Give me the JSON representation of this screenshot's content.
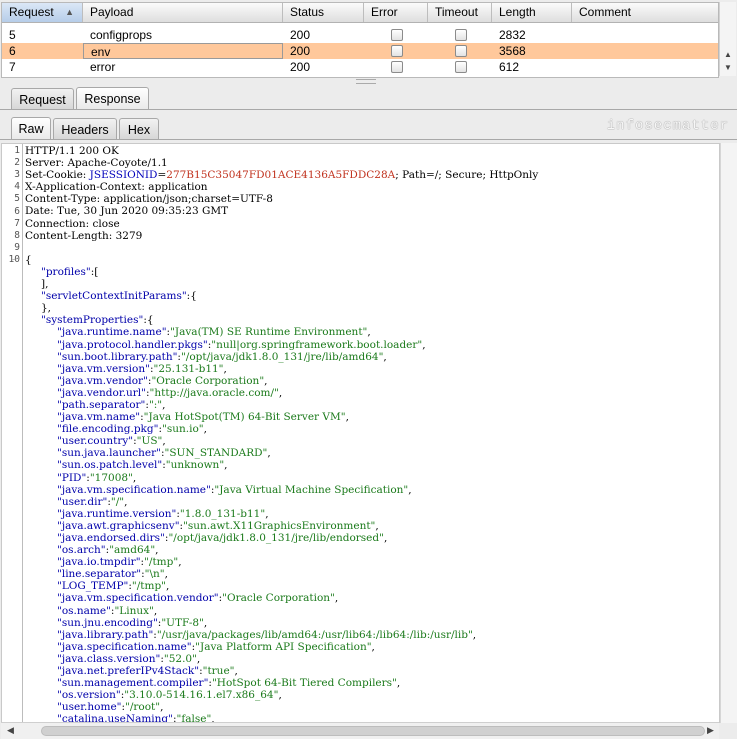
{
  "results_table": {
    "columns": [
      {
        "label": "Request"
      },
      {
        "label": "Payload"
      },
      {
        "label": "Status"
      },
      {
        "label": "Error"
      },
      {
        "label": "Timeout"
      },
      {
        "label": "Length"
      },
      {
        "label": "Comment"
      }
    ],
    "rows": [
      {
        "request": "5",
        "payload": "configprops",
        "status": "200",
        "length": "2832",
        "comment": "",
        "selected": false
      },
      {
        "request": "6",
        "payload": "env",
        "status": "200",
        "length": "3568",
        "comment": "",
        "selected": true
      },
      {
        "request": "7",
        "payload": "error",
        "status": "200",
        "length": "612",
        "comment": "",
        "selected": false
      }
    ]
  },
  "tabs": {
    "main": [
      "Request",
      "Response"
    ],
    "active_main": "Response",
    "view": [
      "Raw",
      "Headers",
      "Hex"
    ],
    "active_view": "Raw"
  },
  "watermark": "infosecmatter",
  "response": {
    "headers": [
      {
        "plain": "HTTP/1.1 200 OK"
      },
      {
        "plain": "Server: Apache-Coyote/1.1"
      },
      {
        "cookie_prefix": "Set-Cookie: ",
        "cookie_name": "JSESSIONID",
        "cookie_eq": "=",
        "cookie_value": "277B15C35047FD01ACE4136A5FDDC28A",
        "cookie_rest": "; Path=/; Secure; HttpOnly"
      },
      {
        "plain": "X-Application-Context: application"
      },
      {
        "plain": "Content-Type: application/json;charset=UTF-8"
      },
      {
        "plain": "Date: Tue, 30 Jun 2020 09:35:23 GMT"
      },
      {
        "plain": "Connection: close"
      },
      {
        "plain": "Content-Length: 3279"
      },
      {
        "plain": ""
      }
    ],
    "body_lines": [
      {
        "indent": 0,
        "pre": "{"
      },
      {
        "indent": 1,
        "key": "\"profiles\"",
        "post": ":["
      },
      {
        "indent": 1,
        "pre": "],"
      },
      {
        "indent": 1,
        "key": "\"servletContextInitParams\"",
        "post": ":{"
      },
      {
        "indent": 1,
        "pre": "},"
      },
      {
        "indent": 1,
        "key": "\"systemProperties\"",
        "post": ":{"
      },
      {
        "indent": 2,
        "key": "\"java.runtime.name\"",
        "val": "\"Java(TM) SE Runtime Environment\"",
        "post": ","
      },
      {
        "indent": 2,
        "key": "\"java.protocol.handler.pkgs\"",
        "val": "\"null|org.springframework.boot.loader\"",
        "post": ","
      },
      {
        "indent": 2,
        "key": "\"sun.boot.library.path\"",
        "val": "\"/opt/java/jdk1.8.0_131/jre/lib/amd64\"",
        "post": ","
      },
      {
        "indent": 2,
        "key": "\"java.vm.version\"",
        "val": "\"25.131-b11\"",
        "post": ","
      },
      {
        "indent": 2,
        "key": "\"java.vm.vendor\"",
        "val": "\"Oracle Corporation\"",
        "post": ","
      },
      {
        "indent": 2,
        "key": "\"java.vendor.url\"",
        "val": "\"http://java.oracle.com/\"",
        "post": ","
      },
      {
        "indent": 2,
        "key": "\"path.separator\"",
        "val": "\":\"",
        "post": ","
      },
      {
        "indent": 2,
        "key": "\"java.vm.name\"",
        "val": "\"Java HotSpot(TM) 64-Bit Server VM\"",
        "post": ","
      },
      {
        "indent": 2,
        "key": "\"file.encoding.pkg\"",
        "val": "\"sun.io\"",
        "post": ","
      },
      {
        "indent": 2,
        "key": "\"user.country\"",
        "val": "\"US\"",
        "post": ","
      },
      {
        "indent": 2,
        "key": "\"sun.java.launcher\"",
        "val": "\"SUN_STANDARD\"",
        "post": ","
      },
      {
        "indent": 2,
        "key": "\"sun.os.patch.level\"",
        "val": "\"unknown\"",
        "post": ","
      },
      {
        "indent": 2,
        "key": "\"PID\"",
        "val": "\"17008\"",
        "post": ","
      },
      {
        "indent": 2,
        "key": "\"java.vm.specification.name\"",
        "val": "\"Java Virtual Machine Specification\"",
        "post": ","
      },
      {
        "indent": 2,
        "key": "\"user.dir\"",
        "val": "\"/\"",
        "post": ","
      },
      {
        "indent": 2,
        "key": "\"java.runtime.version\"",
        "val": "\"1.8.0_131-b11\"",
        "post": ","
      },
      {
        "indent": 2,
        "key": "\"java.awt.graphicsenv\"",
        "val": "\"sun.awt.X11GraphicsEnvironment\"",
        "post": ","
      },
      {
        "indent": 2,
        "key": "\"java.endorsed.dirs\"",
        "val": "\"/opt/java/jdk1.8.0_131/jre/lib/endorsed\"",
        "post": ","
      },
      {
        "indent": 2,
        "key": "\"os.arch\"",
        "val": "\"amd64\"",
        "post": ","
      },
      {
        "indent": 2,
        "key": "\"java.io.tmpdir\"",
        "val": "\"/tmp\"",
        "post": ","
      },
      {
        "indent": 2,
        "key": "\"line.separator\"",
        "val": "\"\\n\"",
        "post": ","
      },
      {
        "indent": 2,
        "key": "\"LOG_TEMP\"",
        "val": "\"/tmp\"",
        "post": ","
      },
      {
        "indent": 2,
        "key": "\"java.vm.specification.vendor\"",
        "val": "\"Oracle Corporation\"",
        "post": ","
      },
      {
        "indent": 2,
        "key": "\"os.name\"",
        "val": "\"Linux\"",
        "post": ","
      },
      {
        "indent": 2,
        "key": "\"sun.jnu.encoding\"",
        "val": "\"UTF-8\"",
        "post": ","
      },
      {
        "indent": 2,
        "key": "\"java.library.path\"",
        "val": "\"/usr/java/packages/lib/amd64:/usr/lib64:/lib64:/lib:/usr/lib\"",
        "post": ","
      },
      {
        "indent": 2,
        "key": "\"java.specification.name\"",
        "val": "\"Java Platform API Specification\"",
        "post": ","
      },
      {
        "indent": 2,
        "key": "\"java.class.version\"",
        "val": "\"52.0\"",
        "post": ","
      },
      {
        "indent": 2,
        "key": "\"java.net.preferIPv4Stack\"",
        "val": "\"true\"",
        "post": ","
      },
      {
        "indent": 2,
        "key": "\"sun.management.compiler\"",
        "val": "\"HotSpot 64-Bit Tiered Compilers\"",
        "post": ","
      },
      {
        "indent": 2,
        "key": "\"os.version\"",
        "val": "\"3.10.0-514.16.1.el7.x86_64\"",
        "post": ","
      },
      {
        "indent": 2,
        "key": "\"user.home\"",
        "val": "\"/root\"",
        "post": ","
      },
      {
        "indent": 2,
        "key": "\"catalina.useNaming\"",
        "val": "\"false\"",
        "post": ","
      }
    ]
  },
  "colors": {
    "selected_row": "#ffc89b",
    "json_key": "#0000aa",
    "json_value": "#1b7a1b",
    "cookie_value": "#c0311d"
  }
}
